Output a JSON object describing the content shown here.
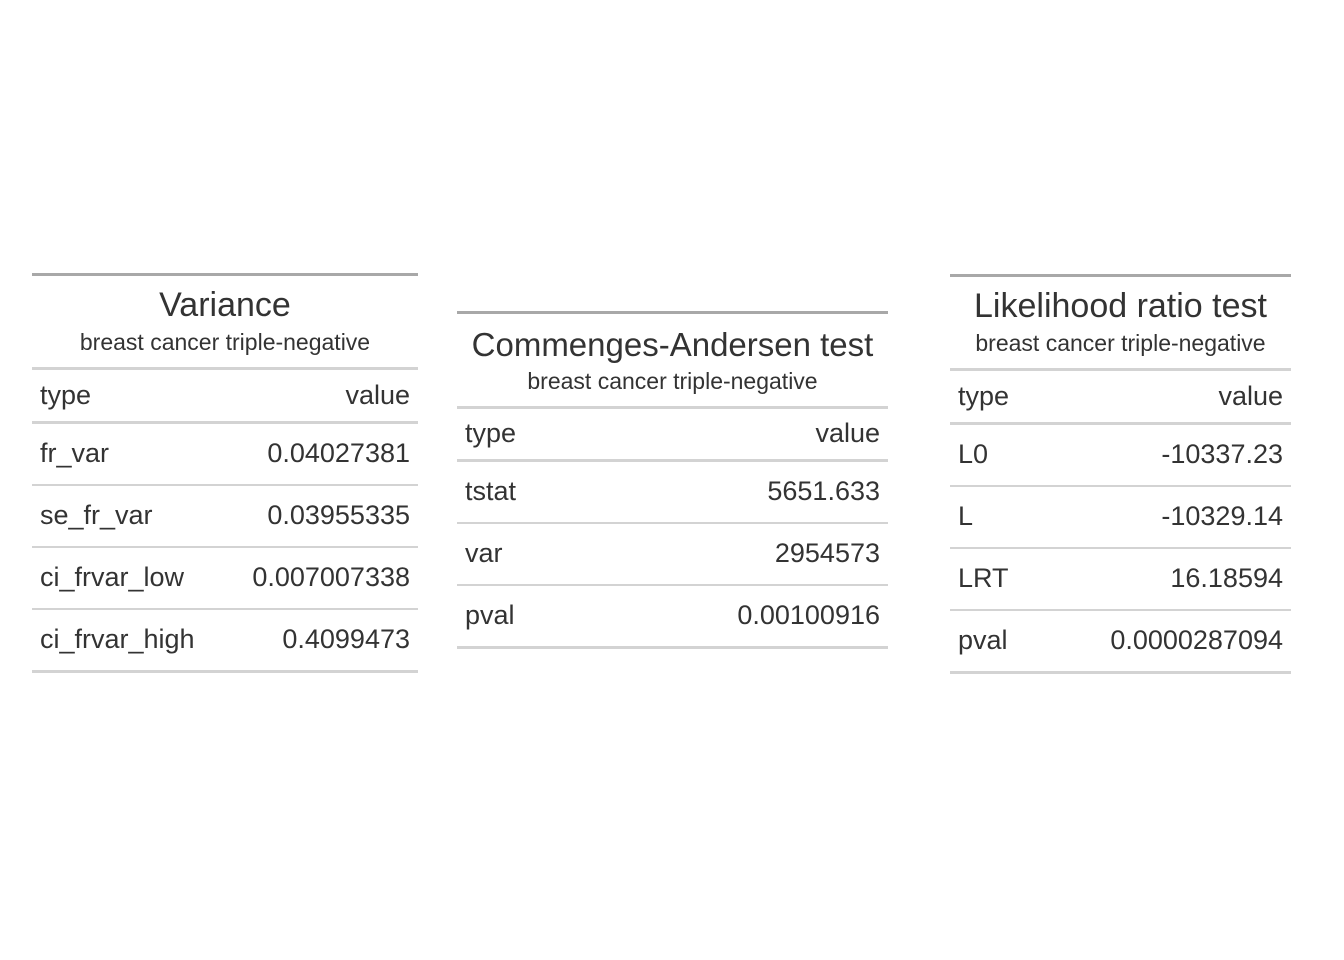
{
  "tables": [
    {
      "title": "Variance",
      "subtitle": "breast cancer triple-negative",
      "columns": [
        "type",
        "value"
      ],
      "rows": [
        {
          "type": "fr_var",
          "value": "0.04027381"
        },
        {
          "type": "se_fr_var",
          "value": "0.03955335"
        },
        {
          "type": "ci_frvar_low",
          "value": "0.007007338"
        },
        {
          "type": "ci_frvar_high",
          "value": "0.4099473"
        }
      ]
    },
    {
      "title": "Commenges-Andersen test",
      "subtitle": "breast cancer triple-negative",
      "columns": [
        "type",
        "value"
      ],
      "rows": [
        {
          "type": "tstat",
          "value": "5651.633"
        },
        {
          "type": "var",
          "value": "2954573"
        },
        {
          "type": "pval",
          "value": "0.00100916"
        }
      ]
    },
    {
      "title": "Likelihood ratio test",
      "subtitle": "breast cancer triple-negative",
      "columns": [
        "type",
        "value"
      ],
      "rows": [
        {
          "type": "L0",
          "value": "-10337.23"
        },
        {
          "type": "L",
          "value": "-10329.14"
        },
        {
          "type": "LRT",
          "value": "16.18594"
        },
        {
          "type": "pval",
          "value": "0.0000287094"
        }
      ]
    }
  ]
}
